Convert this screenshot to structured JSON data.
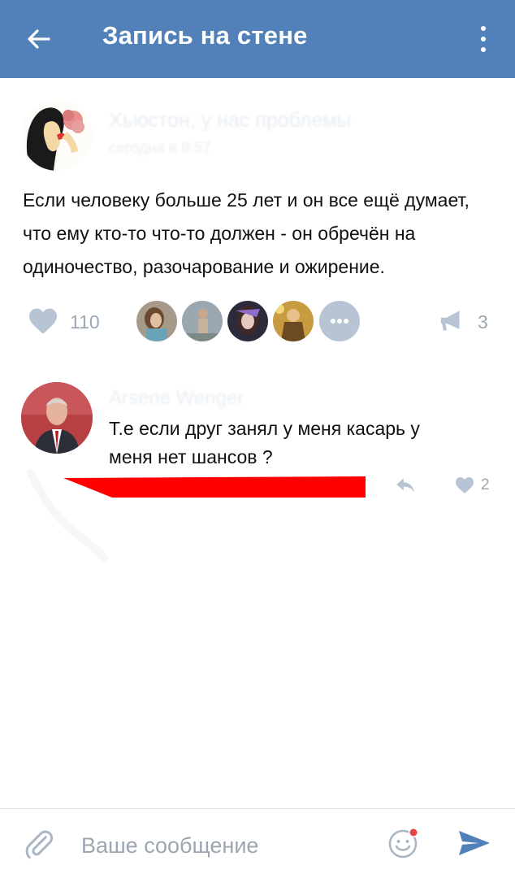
{
  "header": {
    "title": "Запись на стене",
    "bg_color": "#5181b8",
    "back_icon": "arrow-left-icon",
    "menu_icon": "more-vertical-icon"
  },
  "post": {
    "author": "Хьюстон, у нас проблемы",
    "time": "сегодня в 8:57",
    "text_lines": [
      "Если человеку больше 25 лет и он все ещё думает,",
      "что ему кто-то что-то должен - он обречён на",
      "одиночество, разочарование и ожирение."
    ],
    "likes_count": "110",
    "shares_count": "3"
  },
  "comment": {
    "author": "Arsene Wenger",
    "text_lines": [
      "Т.е если друг  занял у меня касарь у",
      "меня нет шансов ?"
    ],
    "likes_count": "2"
  },
  "composer": {
    "placeholder": "Ваше сообщение"
  },
  "colors": {
    "accent": "#5181b8",
    "muted_icon": "#b7c4d3",
    "counter_text": "#9aa7b5",
    "red_mark": "#ff0000"
  }
}
